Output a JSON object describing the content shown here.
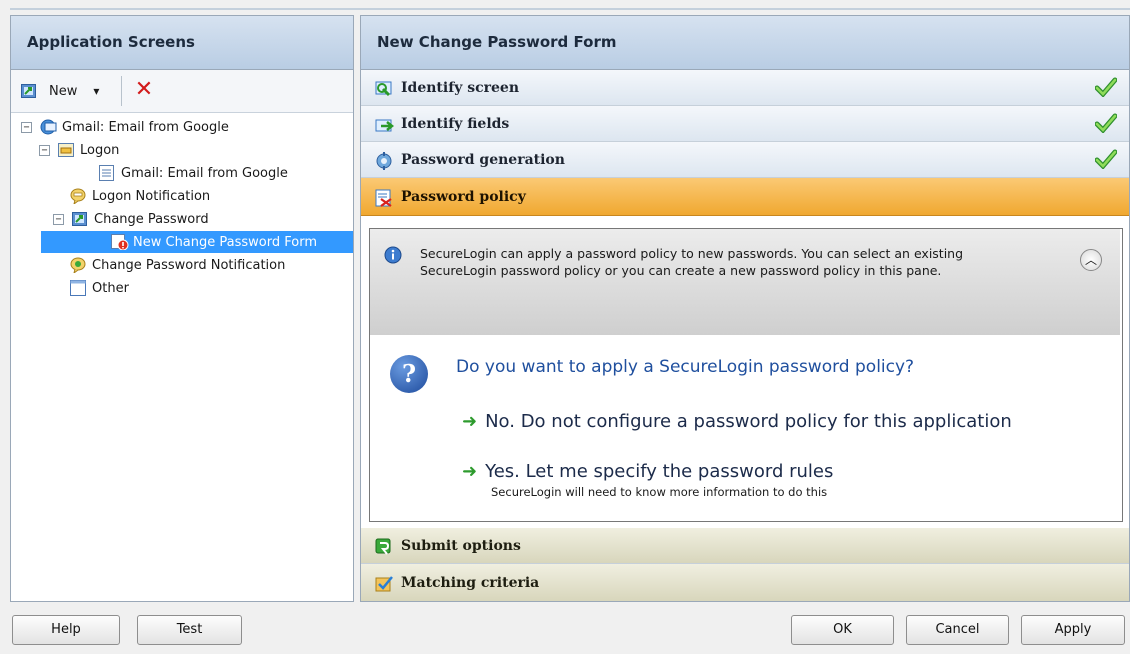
{
  "left_panel": {
    "title": "Application Screens",
    "toolbar": {
      "new_label": "New",
      "dropdown_glyph": "▾",
      "delete_glyph": "✕"
    },
    "tree": [
      {
        "label": "Gmail: Email from Google",
        "expander": "−"
      },
      {
        "label": "Logon",
        "expander": "−"
      },
      {
        "label": "Gmail: Email from Google"
      },
      {
        "label": "Logon Notification"
      },
      {
        "label": "Change Password",
        "expander": "−"
      },
      {
        "label": "New Change Password Form",
        "selected": true
      },
      {
        "label": "Change Password Notification"
      },
      {
        "label": "Other"
      }
    ]
  },
  "right_panel": {
    "title": "New Change Password Form",
    "sections": {
      "identify_screen": {
        "label": "Identify screen",
        "complete": true
      },
      "identify_fields": {
        "label": "Identify fields",
        "complete": true
      },
      "password_generation": {
        "label": "Password generation",
        "complete": true
      },
      "password_policy": {
        "label": "Password policy",
        "expanded": true
      },
      "submit_options": {
        "label": "Submit options"
      },
      "matching_criteria": {
        "label": "Matching criteria"
      }
    },
    "info_text": "SecureLogin can apply a password policy to new passwords. You can select an existing SecureLogin password policy or you can create a new password policy in this pane.",
    "question": "Do you want to apply a SecureLogin password policy?",
    "options": [
      {
        "label": "No. Do not configure a password policy for this application"
      },
      {
        "label": "Yes. Let me specify the password rules",
        "sub": "SecureLogin will need to know more information to do this"
      }
    ]
  },
  "buttons": {
    "help": "Help",
    "test": "Test",
    "ok": "OK",
    "cancel": "Cancel",
    "apply": "Apply"
  },
  "colors": {
    "selection": "#3399ff",
    "active_section": "#f0a830",
    "check": "#3aa93a",
    "link_text": "#1f4f9e"
  }
}
